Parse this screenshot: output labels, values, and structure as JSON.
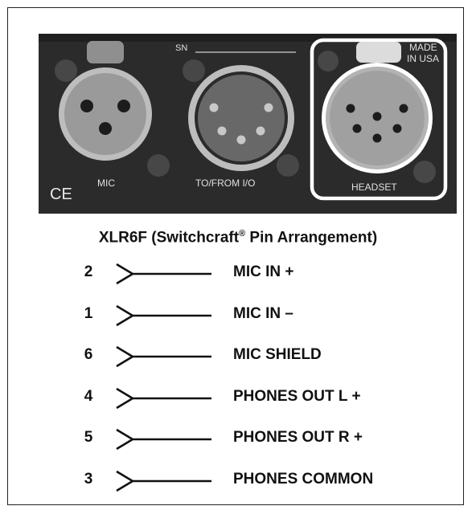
{
  "panel": {
    "sn_label": "SN",
    "made_in_usa": [
      "MADE",
      "IN USA"
    ],
    "ce_mark": "CE",
    "connectors": [
      {
        "label": "MIC"
      },
      {
        "label": "TO/FROM I/O"
      },
      {
        "label": "HEADSET"
      }
    ]
  },
  "pinout": {
    "title_main": "XLR6F (Switchcraft",
    "title_reg": "®",
    "title_end": " Pin Arrangement)",
    "pins": [
      {
        "number": "2",
        "signal": "MIC IN +"
      },
      {
        "number": "1",
        "signal": "MIC IN –"
      },
      {
        "number": "6",
        "signal": "MIC SHIELD"
      },
      {
        "number": "4",
        "signal": "PHONES OUT L +"
      },
      {
        "number": "5",
        "signal": "PHONES OUT R +"
      },
      {
        "number": "3",
        "signal": "PHONES COMMON"
      }
    ]
  },
  "colors": {
    "panel": "#2b2b2b",
    "connector_face": "#9a9a9a",
    "connector_ring": "#bdbdbd",
    "screw": "#4a4a4a",
    "highlight": "#ffffff",
    "text_dark": "#111111"
  }
}
